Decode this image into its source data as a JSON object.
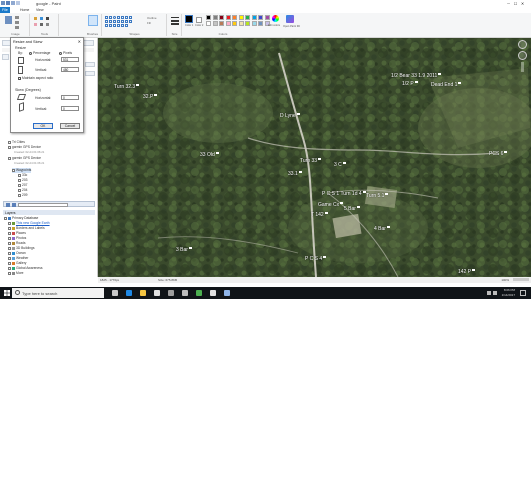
{
  "window": {
    "title": "google - Paint"
  },
  "ribbon": {
    "tabs": [
      "File",
      "Home",
      "View"
    ],
    "groups": [
      "Image",
      "Tools",
      "Brushes",
      "Shapes",
      "Size",
      "Colors"
    ],
    "shapes_options": [
      "Outline",
      "Fill"
    ],
    "color_buttons": [
      "Color 1",
      "Color 2",
      "Edit colors",
      "Open Paint 3D"
    ],
    "size_label": "Size",
    "colors": [
      "#000000",
      "#7f7f7f",
      "#880015",
      "#ed1c24",
      "#ff7f27",
      "#fff200",
      "#22b14c",
      "#00a2e8",
      "#3f48cc",
      "#a349a4",
      "#ffffff",
      "#c3c3c3",
      "#b97a57",
      "#ffaec9",
      "#ffc90e",
      "#efe4b0",
      "#b5e61d",
      "#99d9ea",
      "#7092be",
      "#c8bfe7"
    ]
  },
  "dialog": {
    "title": "Resize and Skew",
    "close": "✕",
    "resize_section": "Resize",
    "by_label": "By:",
    "percentage": "Percentage",
    "pixels": "Pixels",
    "horizontal_label": "Horizontal:",
    "horizontal_value": "531",
    "vertical_label": "Vertical:",
    "vertical_value": "480",
    "maintain_aspect": "Maintain aspect ratio",
    "skew_section": "Skew (Degrees)",
    "skew_horizontal_value": "0",
    "skew_vertical_value": "0",
    "ok": "OK",
    "cancel": "Cancel"
  },
  "places": {
    "items": [
      {
        "label": "Tri Cities"
      },
      {
        "label": "garmin GPS Device"
      },
      {
        "label": "Created: 02-24 01:06:21"
      },
      {
        "label": "garmin GPS Device"
      },
      {
        "label": "Created: 02-24 01:06:21"
      },
      {
        "label": "Waypoints"
      },
      {
        "label": "33c"
      },
      {
        "label": "203"
      },
      {
        "label": "207"
      },
      {
        "label": "204"
      },
      {
        "label": "209"
      }
    ]
  },
  "layers": {
    "header": "Layers",
    "items": [
      {
        "label": "Primary Database"
      },
      {
        "label": "This new Google Earth"
      },
      {
        "label": "Borders and Labels"
      },
      {
        "label": "Places"
      },
      {
        "label": "Photos"
      },
      {
        "label": "Roads"
      },
      {
        "label": "3D Buildings"
      },
      {
        "label": "Ocean"
      },
      {
        "label": "Weather"
      },
      {
        "label": "Gallery"
      },
      {
        "label": "Global Awareness"
      },
      {
        "label": "More"
      }
    ]
  },
  "map": {
    "labels": [
      {
        "text": "Turn 32.3"
      },
      {
        "text": "32.P"
      },
      {
        "text": "1/2 Bear 33 1.9 2011"
      },
      {
        "text": "1/2 P"
      },
      {
        "text": "Dead End 1"
      },
      {
        "text": "D Lyne"
      },
      {
        "text": "33 Old"
      },
      {
        "text": "Turn 33"
      },
      {
        "text": "33.1"
      },
      {
        "text": "3 C"
      },
      {
        "text": "PCS 6"
      },
      {
        "text": "P C S 1 Turn 1d 4"
      },
      {
        "text": "Turn 5.1"
      },
      {
        "text": "5 Bar"
      },
      {
        "text": "Game Cx"
      },
      {
        "text": "T 142"
      },
      {
        "text": "4 Bar"
      },
      {
        "text": "3 Bar"
      },
      {
        "text": "P C S 4"
      },
      {
        "text": "142 P"
      }
    ],
    "status_left": "1825 - 1776px",
    "status_right": "Size: 675.8KB"
  },
  "status": {
    "zoom": "100%"
  },
  "taskbar": {
    "search_placeholder": "Type here to search",
    "time": "8:06 PM",
    "date": "1/14/2017"
  }
}
